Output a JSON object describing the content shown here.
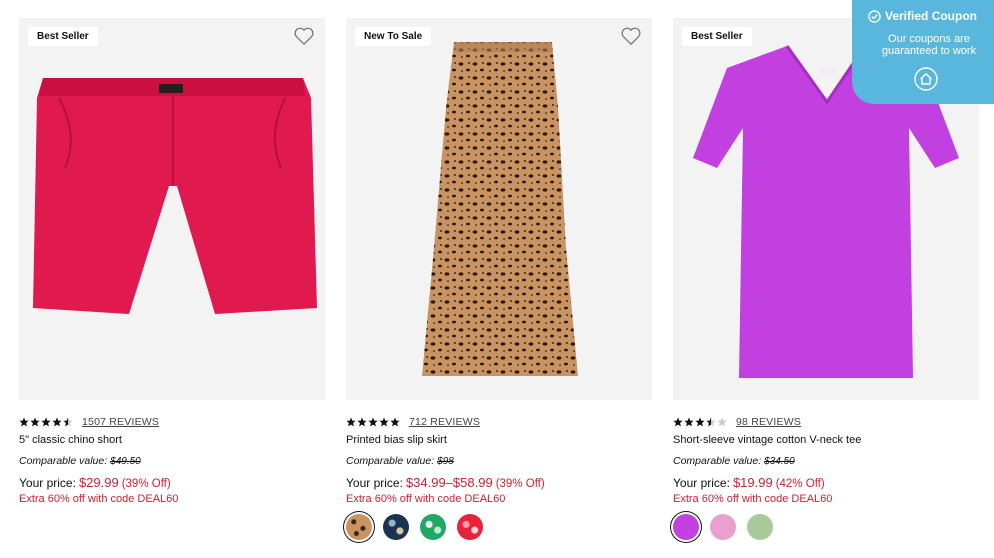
{
  "products": [
    {
      "badge": "Best Seller",
      "rating": 4.5,
      "reviews": "1507 REVIEWS",
      "name": "5\" classic chino short",
      "comparable_label": "Comparable value:",
      "comparable_value": "$49.50",
      "price_label": "Your price:",
      "price": "$29.99",
      "discount": "(39% Off)",
      "extra": "Extra 60% off with code DEAL60",
      "swatches": []
    },
    {
      "badge": "New To Sale",
      "rating": 5,
      "reviews": "712 REVIEWS",
      "name": "Printed bias slip skirt",
      "comparable_label": "Comparable value:",
      "comparable_value": "$98",
      "price_label": "Your price:",
      "price": "$34.99–$58.99",
      "discount": "(39% Off)",
      "extra": "Extra 60% off with code DEAL60",
      "swatches": [
        "leopard",
        "navy-print",
        "green-print",
        "red-print"
      ]
    },
    {
      "badge": "Best Seller",
      "rating": 3.5,
      "reviews": "98 REVIEWS",
      "name": "Short-sleeve vintage cotton V-neck tee",
      "comparable_label": "Comparable value:",
      "comparable_value": "$34.50",
      "price_label": "Your price:",
      "price": "$19.99",
      "discount": "(42% Off)",
      "extra": "Extra 60% off with code DEAL60",
      "swatches": [
        "magenta",
        "pink",
        "sage"
      ]
    }
  ],
  "coupon": {
    "title": "Verified Coupon",
    "description": "Our coupons are guaranteed to work",
    "icon": "home-icon"
  },
  "colors": {
    "sale_red": "#d01f2f",
    "coupon_blue": "#59b7dd",
    "short_red": "#e0194f",
    "tee_purple": "#c23fe0"
  }
}
